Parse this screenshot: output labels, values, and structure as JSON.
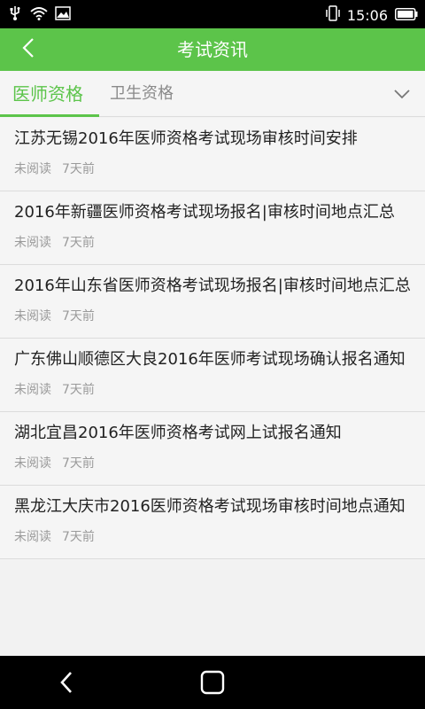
{
  "status_bar": {
    "time": "15:06"
  },
  "header": {
    "title": "考试资讯"
  },
  "tabs": [
    {
      "label": "医师资格",
      "active": true
    },
    {
      "label": "卫生资格",
      "active": false
    }
  ],
  "articles": [
    {
      "title": "江苏无锡2016年医师资格考试现场审核时间安排",
      "status": "未阅读",
      "time": "7天前"
    },
    {
      "title": "2016年新疆医师资格考试现场报名|审核时间地点汇总",
      "status": "未阅读",
      "time": "7天前"
    },
    {
      "title": "2016年山东省医师资格考试现场报名|审核时间地点汇总",
      "status": "未阅读",
      "time": "7天前"
    },
    {
      "title": "广东佛山顺德区大良2016年医师考试现场确认报名通知",
      "status": "未阅读",
      "time": "7天前"
    },
    {
      "title": "湖北宜昌2016年医师资格考试网上试报名通知",
      "status": "未阅读",
      "time": "7天前"
    },
    {
      "title": "黑龙江大庆市2016医师资格考试现场审核时间地点通知",
      "status": "未阅读",
      "time": "7天前"
    }
  ],
  "colors": {
    "accent": "#5cc44a",
    "status_bar": "#000000",
    "background": "#f2f2f2"
  },
  "icons": {
    "back": "chevron-left-icon",
    "expand": "chevron-down-icon",
    "nav_back": "nav-back-icon",
    "nav_home": "nav-home-icon"
  }
}
